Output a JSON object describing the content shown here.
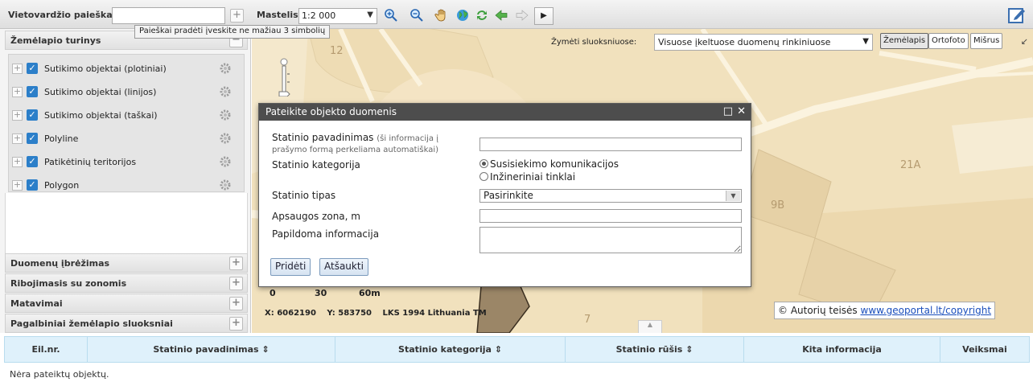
{
  "toolbar": {
    "search_label": "Vietovardžio paieška:",
    "search_value": "",
    "add_symbol": "+",
    "scale_label": "Mastelis:",
    "scale_value": "1:2 000",
    "play_symbol": "▶",
    "tools": [
      "zoom-in-icon",
      "zoom-out-icon",
      "pan-hand-icon",
      "globe-icon",
      "refresh-icon",
      "back-arrow-icon",
      "forward-arrow-icon"
    ]
  },
  "tooltip": "Paieškai pradėti įveskite ne mažiau 3 simbolių",
  "left_panel": {
    "content_title": "Žemėlapio turinys",
    "layers": [
      {
        "label": "Sutikimo objektai (plotiniai)",
        "checked": true
      },
      {
        "label": "Sutikimo objektai (linijos)",
        "checked": true
      },
      {
        "label": "Sutikimo objektai (taškai)",
        "checked": true
      },
      {
        "label": "Polyline",
        "checked": true
      },
      {
        "label": "Patikėtinių teritorijos",
        "checked": true
      },
      {
        "label": "Polygon",
        "checked": true
      }
    ],
    "sections": [
      "Duomenų įbrėžimas",
      "Ribojimasis su zonomis",
      "Matavimai",
      "Pagalbiniai žemėlapio sluoksniai"
    ]
  },
  "map": {
    "filter_label": "Žymėti sluoksniuose:",
    "filter_value": "Visuose įkeltuose duomenų rinkiniuose",
    "map_types": [
      "Žemėlapis",
      "Ortofoto",
      "Mišrus"
    ],
    "active_map_type": "Žemėlapis",
    "labels": {
      "n12": "12",
      "n21a": "21A",
      "n9b": "9B",
      "n7": "7"
    },
    "scalebar": {
      "t0": "0",
      "t30": "30",
      "t60": "60m"
    },
    "coords": {
      "x": "X: 6062190",
      "y": "Y: 583750",
      "crs": "LKS 1994 Lithuania TM"
    },
    "copyright_text": "© Autorių teisės ",
    "copyright_link": "www.geoportal.lt/copyright"
  },
  "dialog": {
    "title": "Pateikite objekto duomenis",
    "name_label": "Statinio pavadinimas",
    "name_hint": "(ši informacija į prašymo formą perkeliama automatiškai)",
    "name_value": "",
    "category_label": "Statinio kategorija",
    "category_options": [
      "Susisiekimo komunikacijos",
      "Inžineriniai tinklai"
    ],
    "category_selected": "Susisiekimo komunikacijos",
    "type_label": "Statinio tipas",
    "type_value": "Pasirinkite",
    "zone_label": "Apsaugos zona, m",
    "zone_value": "",
    "info_label": "Papildoma informacija",
    "info_value": "",
    "add_button": "Pridėti",
    "cancel_button": "Atšaukti"
  },
  "table": {
    "headers": [
      "Eil.nr.",
      "Statinio pavadinimas ⇕",
      "Statinio kategorija ⇕",
      "Statinio rūšis ⇕",
      "Kita informacija",
      "Veiksmai"
    ],
    "empty_message": "Nėra pateiktų objektų."
  },
  "colors": {
    "accent": "#2c7fc9",
    "dialog_title": "#4d4d4d",
    "table_header": "#dff1fb",
    "map_base": "#f2e2c0"
  }
}
